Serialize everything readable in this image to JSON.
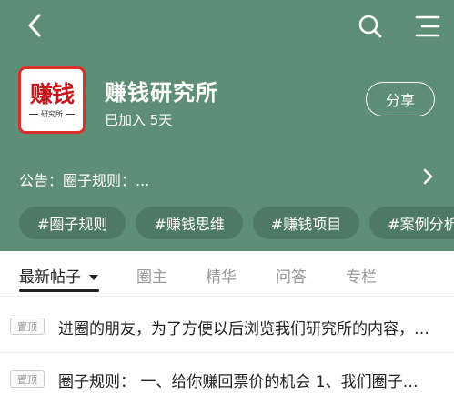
{
  "colors": {
    "header_bg": "#5e8f76",
    "tag_bg": "#4e7a65",
    "logo_red": "#c8161d"
  },
  "nav": {
    "back_icon": "chevron-left-icon",
    "search_icon": "search-icon",
    "menu_icon": "menu-icon"
  },
  "circle": {
    "logo_text": "赚钱",
    "logo_subtext": "研究所",
    "title": "赚钱研究所",
    "status": "已加入 5天",
    "share_label": "分享"
  },
  "notice": {
    "text": "公告：圈子规则：..."
  },
  "tags": [
    "#圈子规则",
    "#赚钱思维",
    "#赚钱项目",
    "#案例分析"
  ],
  "tabs": [
    {
      "label": "最新帖子"
    },
    {
      "label": "圈主"
    },
    {
      "label": "精华"
    },
    {
      "label": "问答"
    },
    {
      "label": "专栏"
    }
  ],
  "posts": [
    {
      "badge": "置顶",
      "text": "进圈的朋友，为了方便以后浏览我们研究所的内容，建议"
    },
    {
      "badge": "置顶",
      "text": "圈子规则： 一、给你赚回票价的机会 1、我们圈子的内容"
    }
  ]
}
